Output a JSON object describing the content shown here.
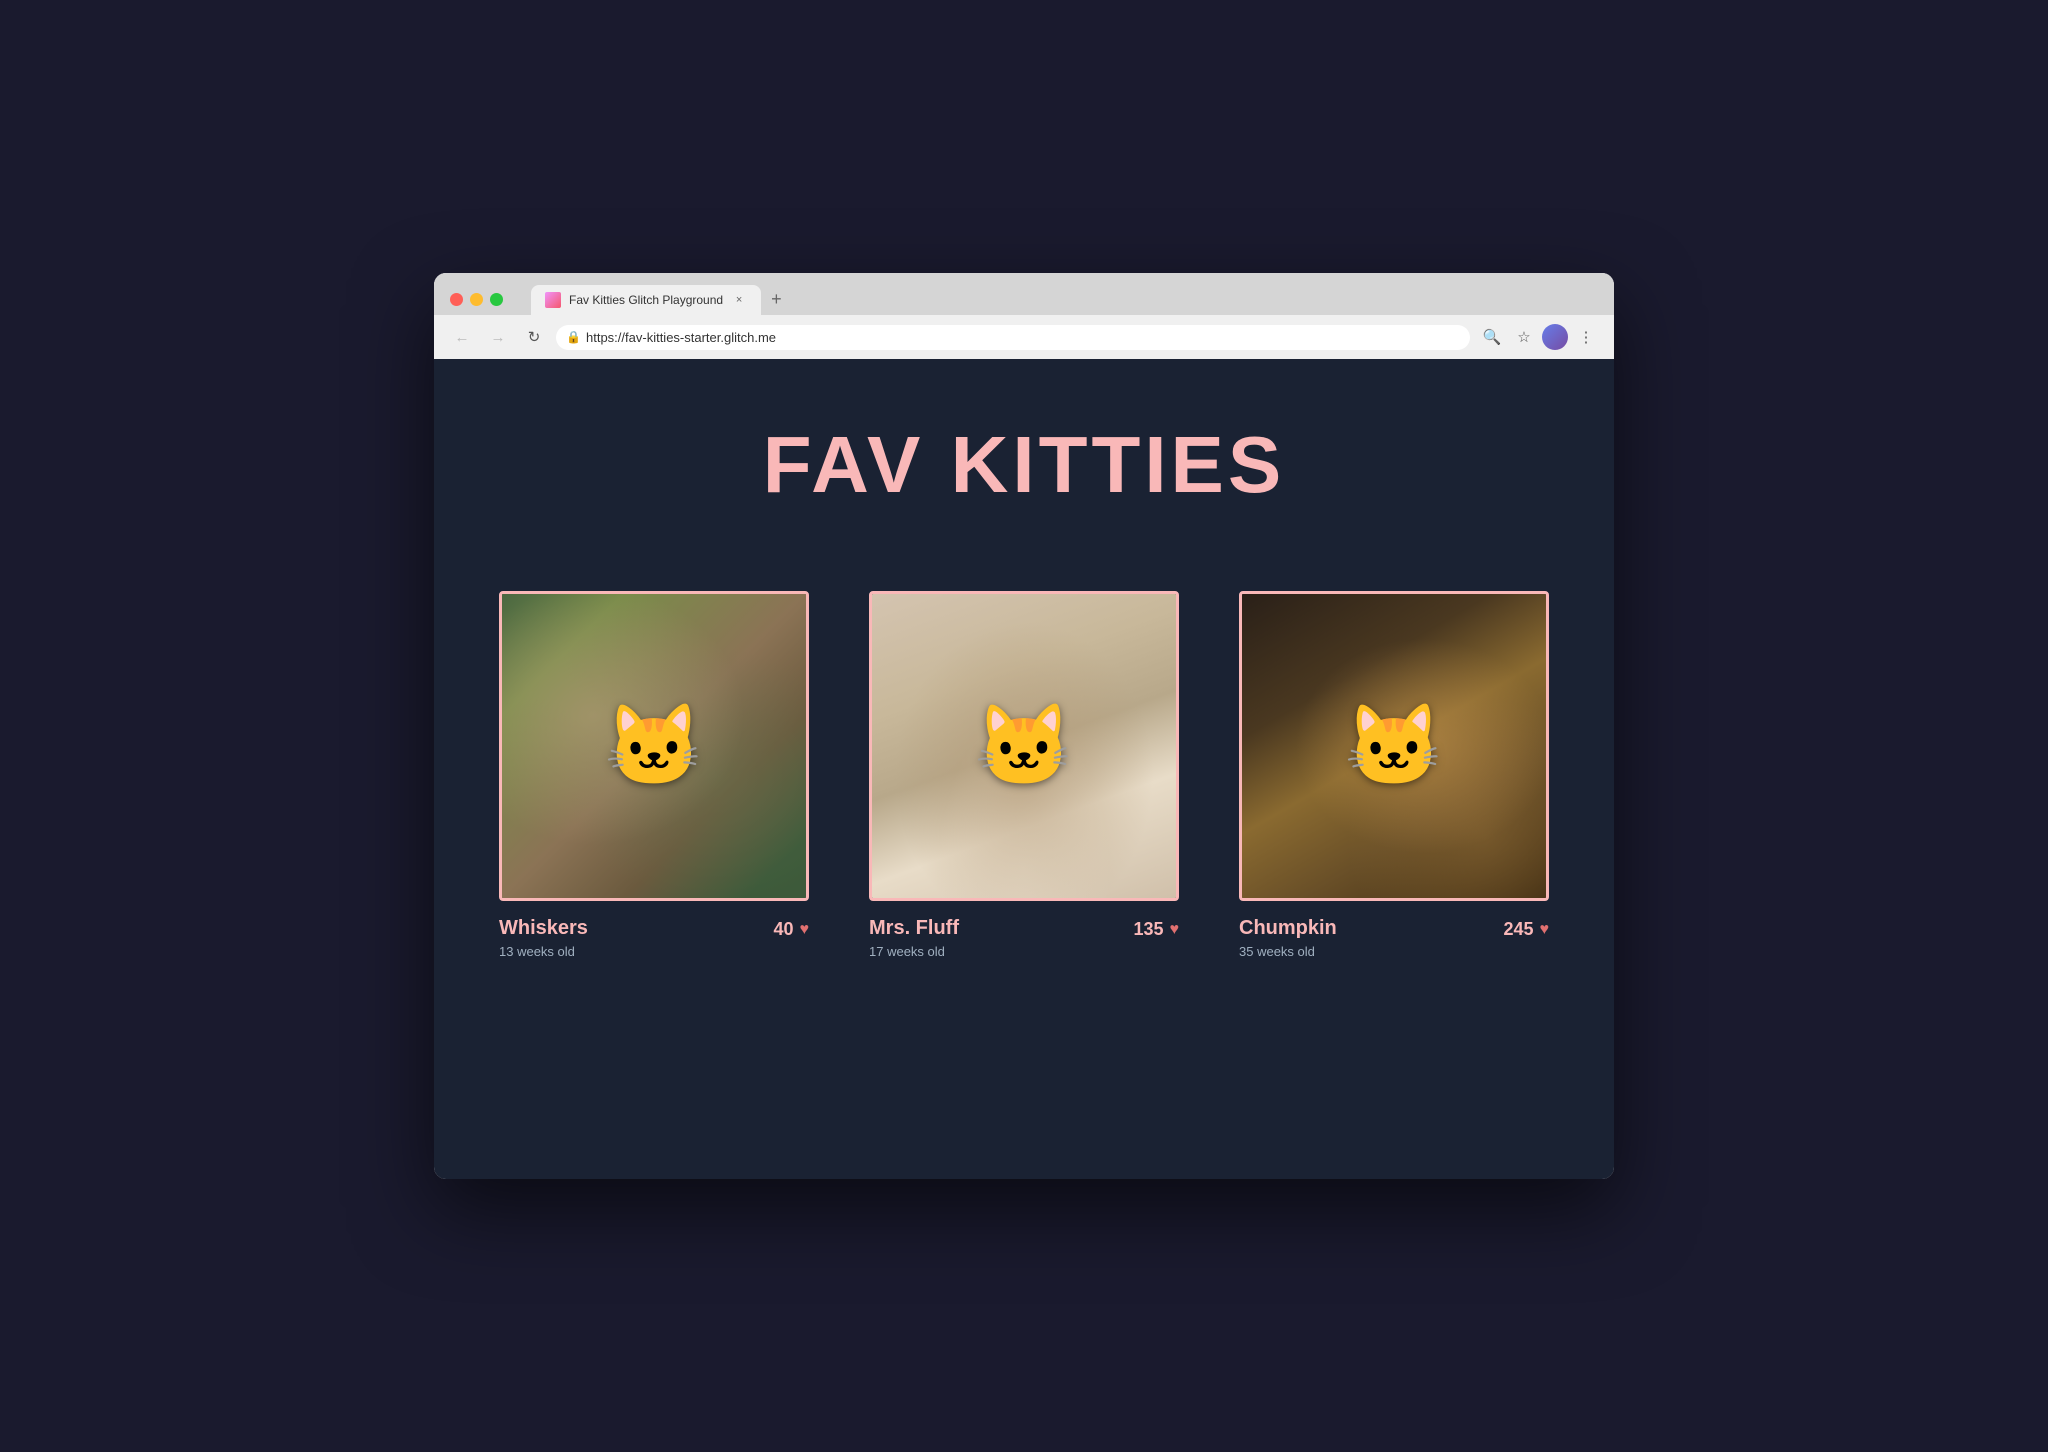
{
  "browser": {
    "tab": {
      "favicon_label": "favicon",
      "title": "Fav Kitties Glitch Playground",
      "close_label": "×"
    },
    "new_tab_label": "+",
    "toolbar": {
      "back_label": "←",
      "forward_label": "→",
      "reload_label": "↻",
      "address": "https://fav-kitties-starter.glitch.me",
      "search_label": "🔍",
      "bookmark_label": "☆",
      "menu_label": "⋮"
    }
  },
  "page": {
    "title": "FAV KITTIES",
    "cats": [
      {
        "id": "whiskers",
        "name": "Whiskers",
        "age": "13 weeks old",
        "hearts": 40,
        "emoji": "🐱"
      },
      {
        "id": "mrs-fluff",
        "name": "Mrs. Fluff",
        "age": "17 weeks old",
        "hearts": 135,
        "emoji": "🐱"
      },
      {
        "id": "chumpkin",
        "name": "Chumpkin",
        "age": "35 weeks old",
        "hearts": 245,
        "emoji": "🐱"
      }
    ],
    "heart_symbol": "♥"
  }
}
